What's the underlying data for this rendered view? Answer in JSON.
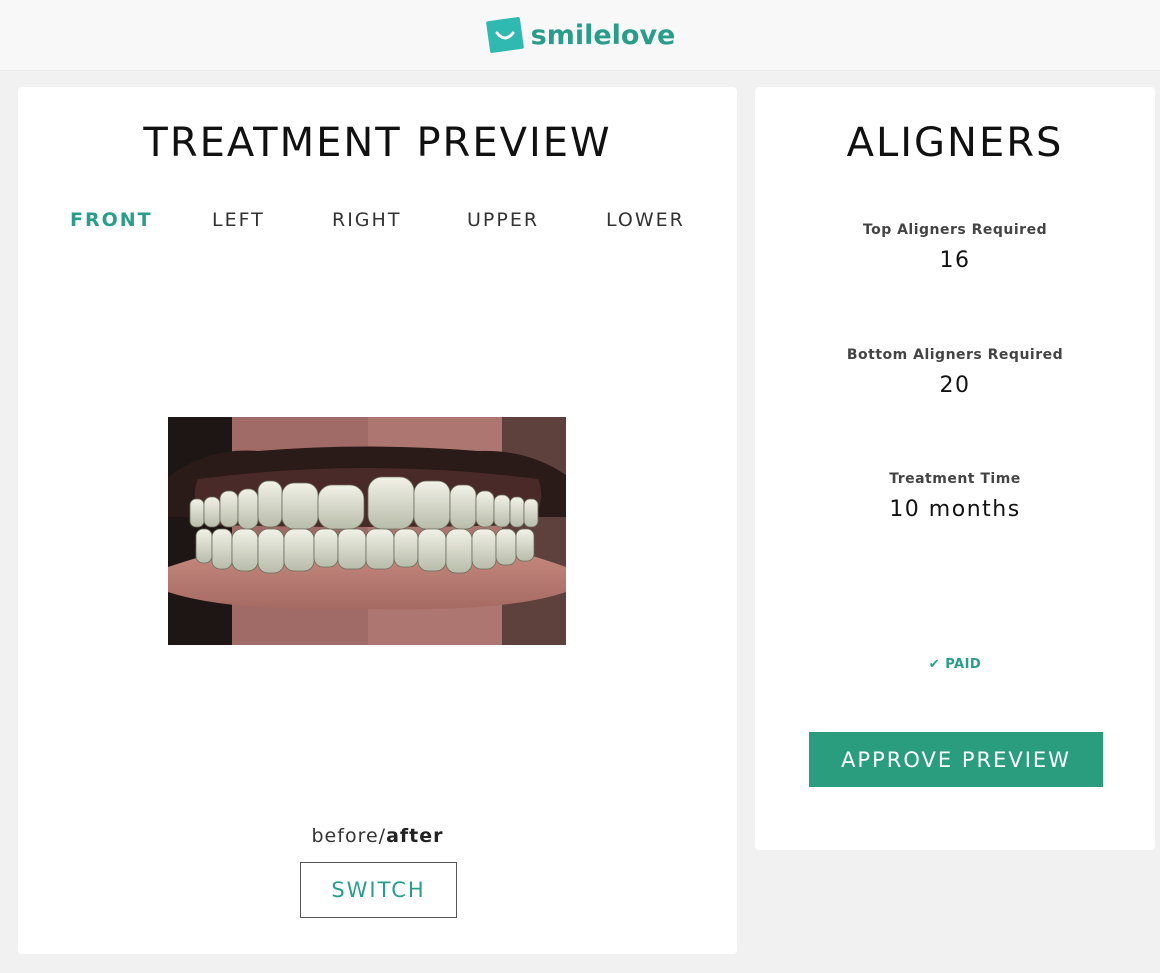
{
  "brand": {
    "name": "smilelove",
    "accent": "#2a9d8a",
    "button_color": "#2a9d7f"
  },
  "preview": {
    "title": "TREATMENT PREVIEW",
    "tabs": [
      {
        "label": "FRONT",
        "active": true
      },
      {
        "label": "LEFT",
        "active": false
      },
      {
        "label": "RIGHT",
        "active": false
      },
      {
        "label": "UPPER",
        "active": false
      },
      {
        "label": "LOWER",
        "active": false
      }
    ],
    "toggle_before": "before/",
    "toggle_after": "after",
    "switch_label": "SWITCH"
  },
  "aligners": {
    "title": "ALIGNERS",
    "stats": [
      {
        "label": "Top Aligners Required",
        "value": "16"
      },
      {
        "label": "Bottom Aligners Required",
        "value": "20"
      },
      {
        "label": "Treatment Time",
        "value": "10 months"
      }
    ],
    "paid_label": "PAID",
    "approve_label": "APPROVE PREVIEW"
  }
}
